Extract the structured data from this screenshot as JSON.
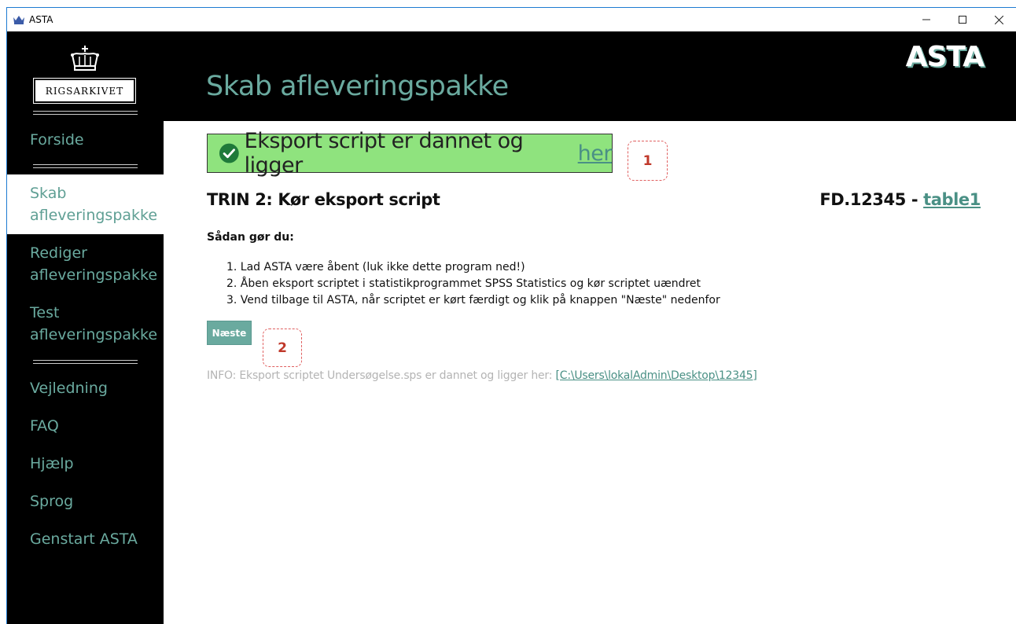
{
  "window": {
    "title": "ASTA",
    "controls": {
      "minimize": "minimize-icon",
      "maximize": "maximize-icon",
      "close": "close-icon"
    }
  },
  "sidebar": {
    "logo_text": "RIGSARKIVET",
    "items": [
      {
        "label": "Forside",
        "active": false
      },
      {
        "label": "Skab afleveringspakke",
        "line1": "Skab",
        "line2": "afleveringspakke",
        "active": true
      },
      {
        "label": "Rediger afleveringspakke",
        "line1": "Rediger",
        "line2": "afleveringspakke",
        "active": false
      },
      {
        "label": "Test afleveringspakke",
        "line1": "Test",
        "line2": "afleveringspakke",
        "active": false
      },
      {
        "label": "Vejledning",
        "active": false
      },
      {
        "label": "FAQ",
        "active": false
      },
      {
        "label": "Hjælp",
        "active": false
      },
      {
        "label": "Sprog",
        "active": false
      },
      {
        "label": "Genstart ASTA",
        "active": false
      }
    ]
  },
  "header": {
    "title": "Skab afleveringspakke",
    "brand": "ASTA"
  },
  "main": {
    "success_message": "Eksport script er dannet og ligger",
    "success_link": "her",
    "step_title": "TRIN 2: Kør eksport script",
    "fd_prefix": "FD.12345 - ",
    "fd_table": "table1",
    "howto_label": "Sådan gør du:",
    "steps": [
      "1. Lad ASTA være åbent (luk ikke dette program ned!)",
      "2. Åben eksport scriptet i statistikprogrammet SPSS Statistics og kør scriptet uændret",
      "3. Vend tilbage til ASTA, når scriptet er kørt færdigt og klik på knappen \"Næste\" nedenfor"
    ],
    "next_button": "Næste",
    "info_text": "INFO: Eksport scriptet Undersøgelse.sps er dannet og ligger her: ",
    "info_path": "[C:\\Users\\lokalAdmin\\Desktop\\12345]"
  },
  "callouts": {
    "one": "1",
    "two": "2"
  },
  "colors": {
    "accent": "#6aaa9f",
    "success_bg": "#8fe37e",
    "sidebar_bg": "#000000",
    "callout_red": "#c0392b"
  }
}
